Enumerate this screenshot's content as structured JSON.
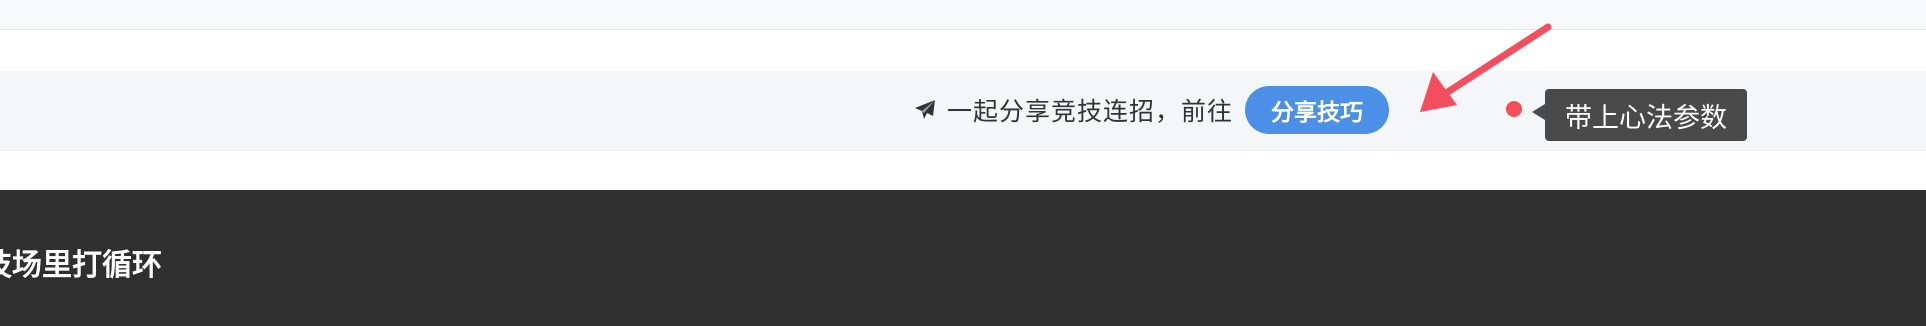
{
  "share_bar": {
    "text": "一起分享竞技连招，前往",
    "button_label": "分享技巧",
    "plane_icon": "paper-plane-icon"
  },
  "tooltip": {
    "text": "带上心法参数"
  },
  "dark_section": {
    "title": "技场里打循环"
  },
  "colors": {
    "button_bg": "#4c8fe6",
    "arrow": "#f24e5e",
    "dot": "#f24e5e",
    "tooltip_bg": "#4a4a4a",
    "dark_bg": "#2f2f2f"
  }
}
